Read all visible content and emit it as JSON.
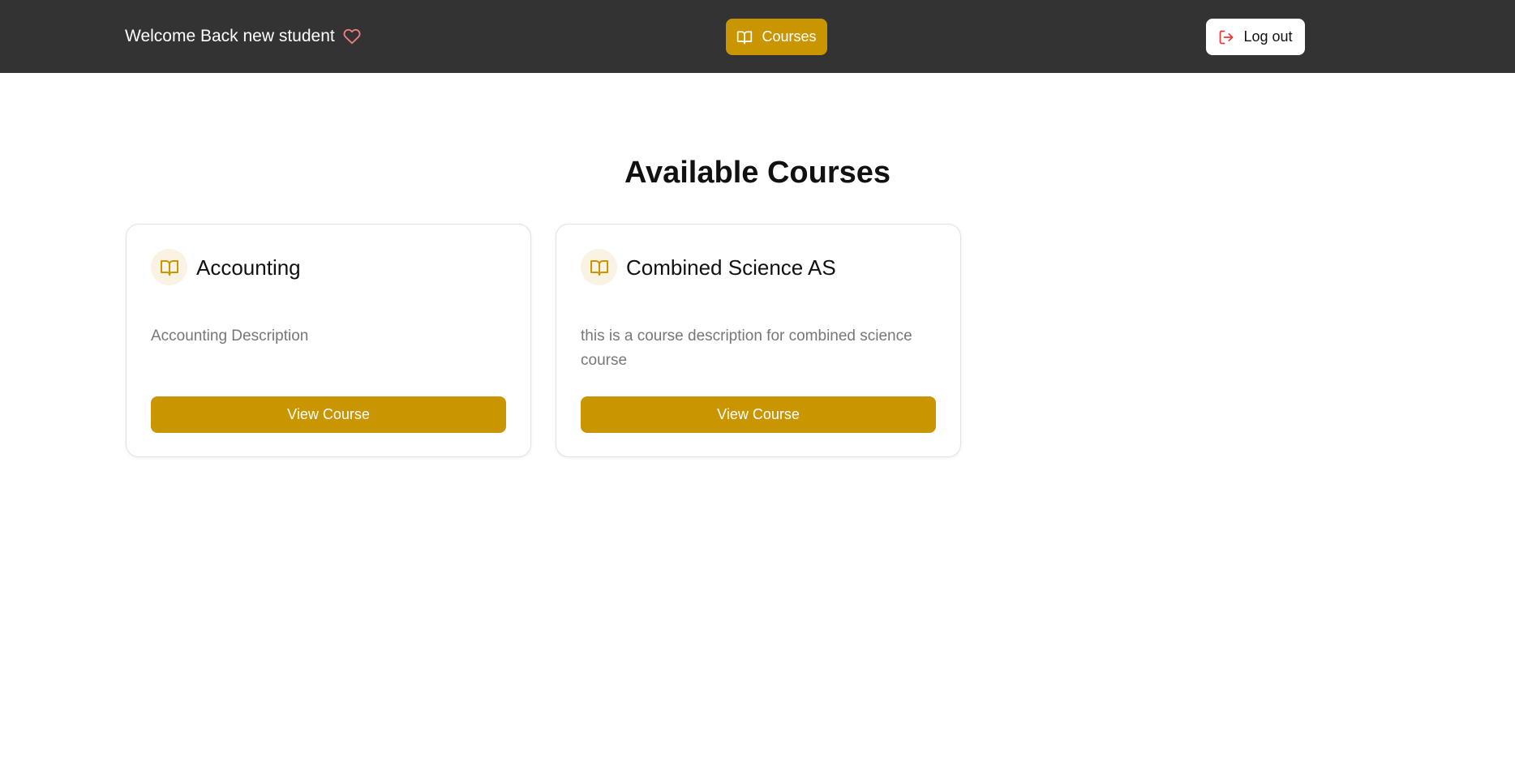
{
  "header": {
    "welcome_text": "Welcome Back new student",
    "nav": {
      "courses_label": "Courses",
      "logout_label": "Log out"
    }
  },
  "main": {
    "title": "Available Courses",
    "courses": [
      {
        "title": "Accounting",
        "description": "Accounting Description",
        "button_label": "View Course"
      },
      {
        "title": "Combined Science AS",
        "description": "this is a course description for combined science course",
        "button_label": "View Course"
      }
    ]
  },
  "icons": {
    "heart": "heart-icon",
    "book": "book-open-icon",
    "logout": "logout-icon"
  },
  "colors": {
    "topbar_bg": "#333333",
    "accent": "#c99500",
    "heart": "#f08080",
    "logout_icon": "#e53935",
    "icon_circle_bg": "#faf3e3"
  }
}
